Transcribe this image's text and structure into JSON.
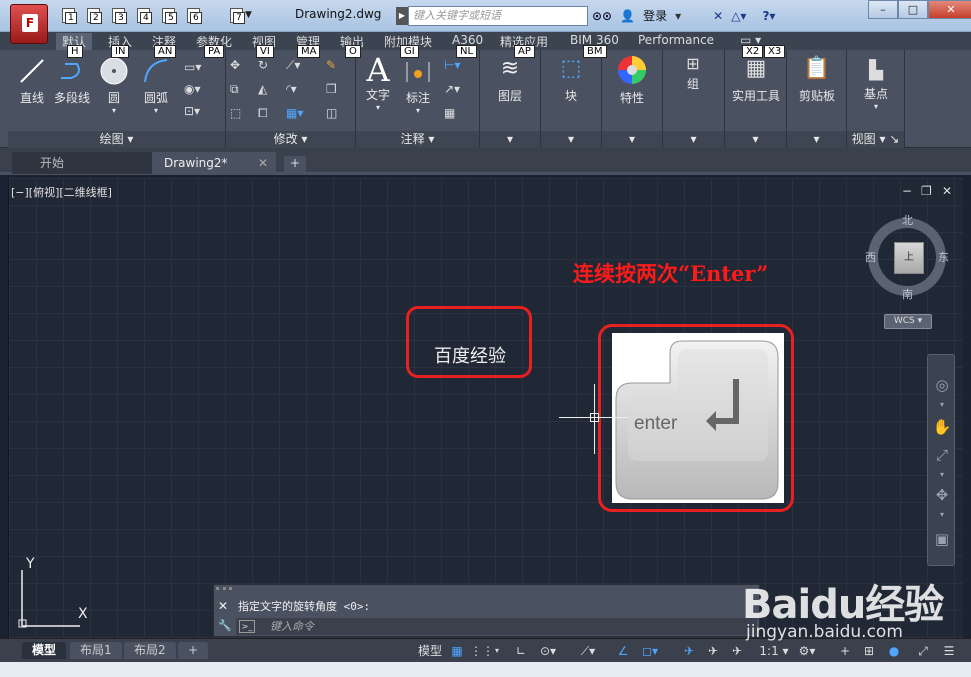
{
  "window": {
    "title": "Drawing2.dwg",
    "search_placeholder": "键入关键字或短语",
    "login": "登录",
    "app_letter": "F",
    "min": "–",
    "max": "□",
    "close": "✕"
  },
  "qat": {
    "keytips": [
      "1",
      "2",
      "3",
      "4",
      "5",
      "6",
      "7"
    ]
  },
  "ribbon_tabs": [
    {
      "label": "默认",
      "key": "H"
    },
    {
      "label": "插入",
      "key": "IN"
    },
    {
      "label": "注释",
      "key": "AN"
    },
    {
      "label": "参数化",
      "key": "PA"
    },
    {
      "label": "视图",
      "key": "VI"
    },
    {
      "label": "管理",
      "key": "MA"
    },
    {
      "label": "输出",
      "key": "O"
    },
    {
      "label": "附加模块",
      "key": "GI"
    },
    {
      "label": "A360",
      "key": "NL"
    },
    {
      "label": "精选应用",
      "key": "AP"
    },
    {
      "label": "BIM 360",
      "key": "BM"
    },
    {
      "label": "Performance",
      "key": ""
    },
    {
      "label": "▭ ▾",
      "key": "X2"
    },
    {
      "label": "",
      "key": "X3"
    }
  ],
  "panels": {
    "draw": {
      "title": "绘图 ▾",
      "tools": [
        "直线",
        "多段线",
        "圆",
        "圆弧"
      ]
    },
    "modify": {
      "title": "修改 ▾"
    },
    "annotate": {
      "title": "注释 ▾",
      "tools": [
        "文字",
        "标注"
      ]
    },
    "layers": {
      "label": "图层"
    },
    "block": {
      "label": "块"
    },
    "properties": {
      "label": "特性"
    },
    "group": {
      "label": "组"
    },
    "utilities": {
      "label": "实用工具"
    },
    "clipboard": {
      "label": "剪贴板"
    },
    "base": {
      "label": "基点"
    },
    "view": {
      "title": "视图 ▾ ↘"
    }
  },
  "file_tabs": {
    "start": "开始",
    "drawing": "Drawing2*",
    "close": "✕",
    "add": "+"
  },
  "viewport": {
    "label": "[−][俯视][二维线框]",
    "controls": [
      "−",
      "❐",
      "✕"
    ],
    "compass": {
      "n": "北",
      "s": "南",
      "e": "东",
      "w": "西"
    },
    "cube_face": "上",
    "wcs": "WCS ▾"
  },
  "annotation": {
    "text": "连续按两次“Enter”",
    "drawn_text": "百度经验",
    "key_label": "enter"
  },
  "ucs": {
    "x": "X",
    "y": "Y"
  },
  "command": {
    "history": "指定文字的旋转角度 <0>:",
    "placeholder": "键入命令",
    "close": "✕"
  },
  "layout_tabs": [
    "模型",
    "布局1",
    "布局2",
    "+"
  ],
  "status": {
    "model": "模型",
    "scale": "1:1 ▾"
  },
  "watermark": {
    "logo": "Baidu经验",
    "url": "jingyan.baidu.com"
  }
}
